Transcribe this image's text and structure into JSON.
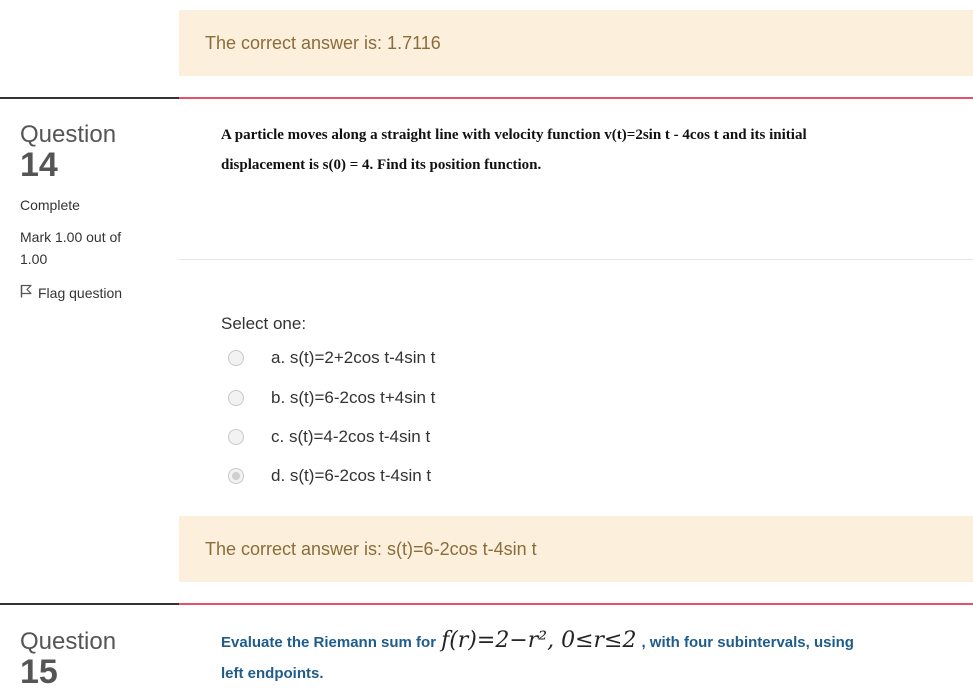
{
  "prev_feedback": {
    "text": "The correct answer is: 1.7116"
  },
  "q14": {
    "label": "Question",
    "number": "14",
    "state": "Complete",
    "mark_line1": "Mark 1.00 out of",
    "mark_line2": "1.00",
    "flag": "Flag question",
    "text_line1": "A particle moves along a straight line with velocity function v(t)=2sin t - 4cos t and its initial",
    "text_line2": "displacement is s(0) = 4. Find its position function.",
    "select_one": "Select one:",
    "options": [
      {
        "label": "a. s(t)=2+2cos t-4sin t",
        "checked": false
      },
      {
        "label": "b. s(t)=6-2cos t+4sin t",
        "checked": false
      },
      {
        "label": "c. s(t)=4-2cos t-4sin t",
        "checked": false
      },
      {
        "label": "d. s(t)=6-2cos t-4sin t",
        "checked": true
      }
    ],
    "feedback": "The correct answer is: s(t)=6-2cos t-4sin t"
  },
  "q15": {
    "label": "Question",
    "number": "15",
    "text_before": "Evaluate the Riemann sum for",
    "math": "f(r)=2−r², 0≤r≤2",
    "text_after": ", with four subintervals, using",
    "text_line2": "left endpoints."
  },
  "colors": {
    "feedback_bg": "#fcefdc",
    "feedback_text": "#8a6d3b",
    "accent_rule": "#e3516b",
    "link_blue": "#1f5c8b"
  }
}
